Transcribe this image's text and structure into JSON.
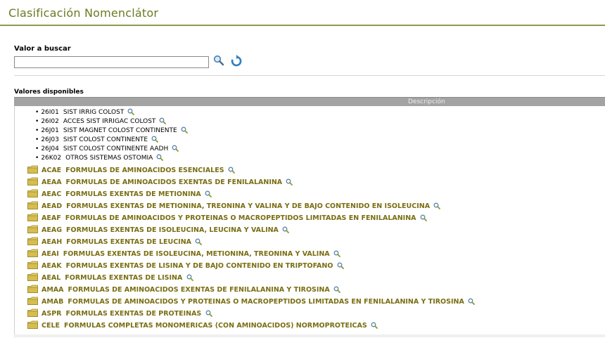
{
  "page": {
    "title": "Clasificación Nomenclátor"
  },
  "search": {
    "label": "Valor a buscar",
    "value": "",
    "search_icon": "magnifier-icon",
    "refresh_icon": "refresh-icon"
  },
  "results": {
    "label": "Valores disponibles",
    "column_header": "Descripción",
    "leaf_items": [
      {
        "code": "26I01",
        "description": "SIST IRRIG COLOST"
      },
      {
        "code": "26I02",
        "description": "ACCES SIST IRRIGAC COLOST"
      },
      {
        "code": "26J01",
        "description": "SIST MAGNET COLOST CONTINENTE"
      },
      {
        "code": "26J03",
        "description": "SIST COLOST CONTINENTE"
      },
      {
        "code": "26J04",
        "description": "SIST COLOST CONTINENTE AADH"
      },
      {
        "code": "26K02",
        "description": "OTROS SISTEMAS OSTOMIA"
      }
    ],
    "folder_items": [
      {
        "code": "ACAE",
        "description": "FORMULAS DE AMINOACIDOS ESENCIALES"
      },
      {
        "code": "AEAA",
        "description": "FORMULAS DE AMINOACIDOS EXENTAS DE FENILALANINA"
      },
      {
        "code": "AEAC",
        "description": "FORMULAS EXENTAS DE METIONINA"
      },
      {
        "code": "AEAD",
        "description": "FORMULAS EXENTAS DE METIONINA, TREONINA Y VALINA Y DE BAJO CONTENIDO EN ISOLEUCINA"
      },
      {
        "code": "AEAF",
        "description": "FORMULAS DE AMINOACIDOS Y PROTEINAS O MACROPEPTIDOS LIMITADAS EN FENILALANINA"
      },
      {
        "code": "AEAG",
        "description": "FORMULAS EXENTAS DE ISOLEUCINA, LEUCINA Y VALINA"
      },
      {
        "code": "AEAH",
        "description": "FORMULAS EXENTAS DE LEUCINA"
      },
      {
        "code": "AEAI",
        "description": "FORMULAS EXENTAS DE ISOLEUCINA, METIONINA, TREONINA Y VALINA"
      },
      {
        "code": "AEAK",
        "description": "FORMULAS EXENTAS DE LISINA Y DE BAJO CONTENIDO EN TRIPTOFANO"
      },
      {
        "code": "AEAL",
        "description": "FORMULAS EXENTAS DE LISINA"
      },
      {
        "code": "AMAA",
        "description": "FORMULAS DE AMINOACIDOS EXENTAS DE FENILALANINA Y TIROSINA"
      },
      {
        "code": "AMAB",
        "description": "FORMULAS DE AMINOACIDOS Y PROTEINAS O MACROPEPTIDOS LIMITADAS EN FENILALANINA Y TIROSINA"
      },
      {
        "code": "ASPR",
        "description": "FORMULAS EXENTAS DE PROTEINAS"
      },
      {
        "code": "CELE",
        "description": "FORMULAS COMPLETAS MONOMERICAS (CON AMINOACIDOS) NORMOPROTEICAS"
      }
    ]
  },
  "colors": {
    "title": "#6b7a22",
    "folder_text": "#7a6e13",
    "folder_icon": "#d9c25a",
    "header_bar": "#a3a3a3",
    "magnifier": "#5a86b0"
  }
}
